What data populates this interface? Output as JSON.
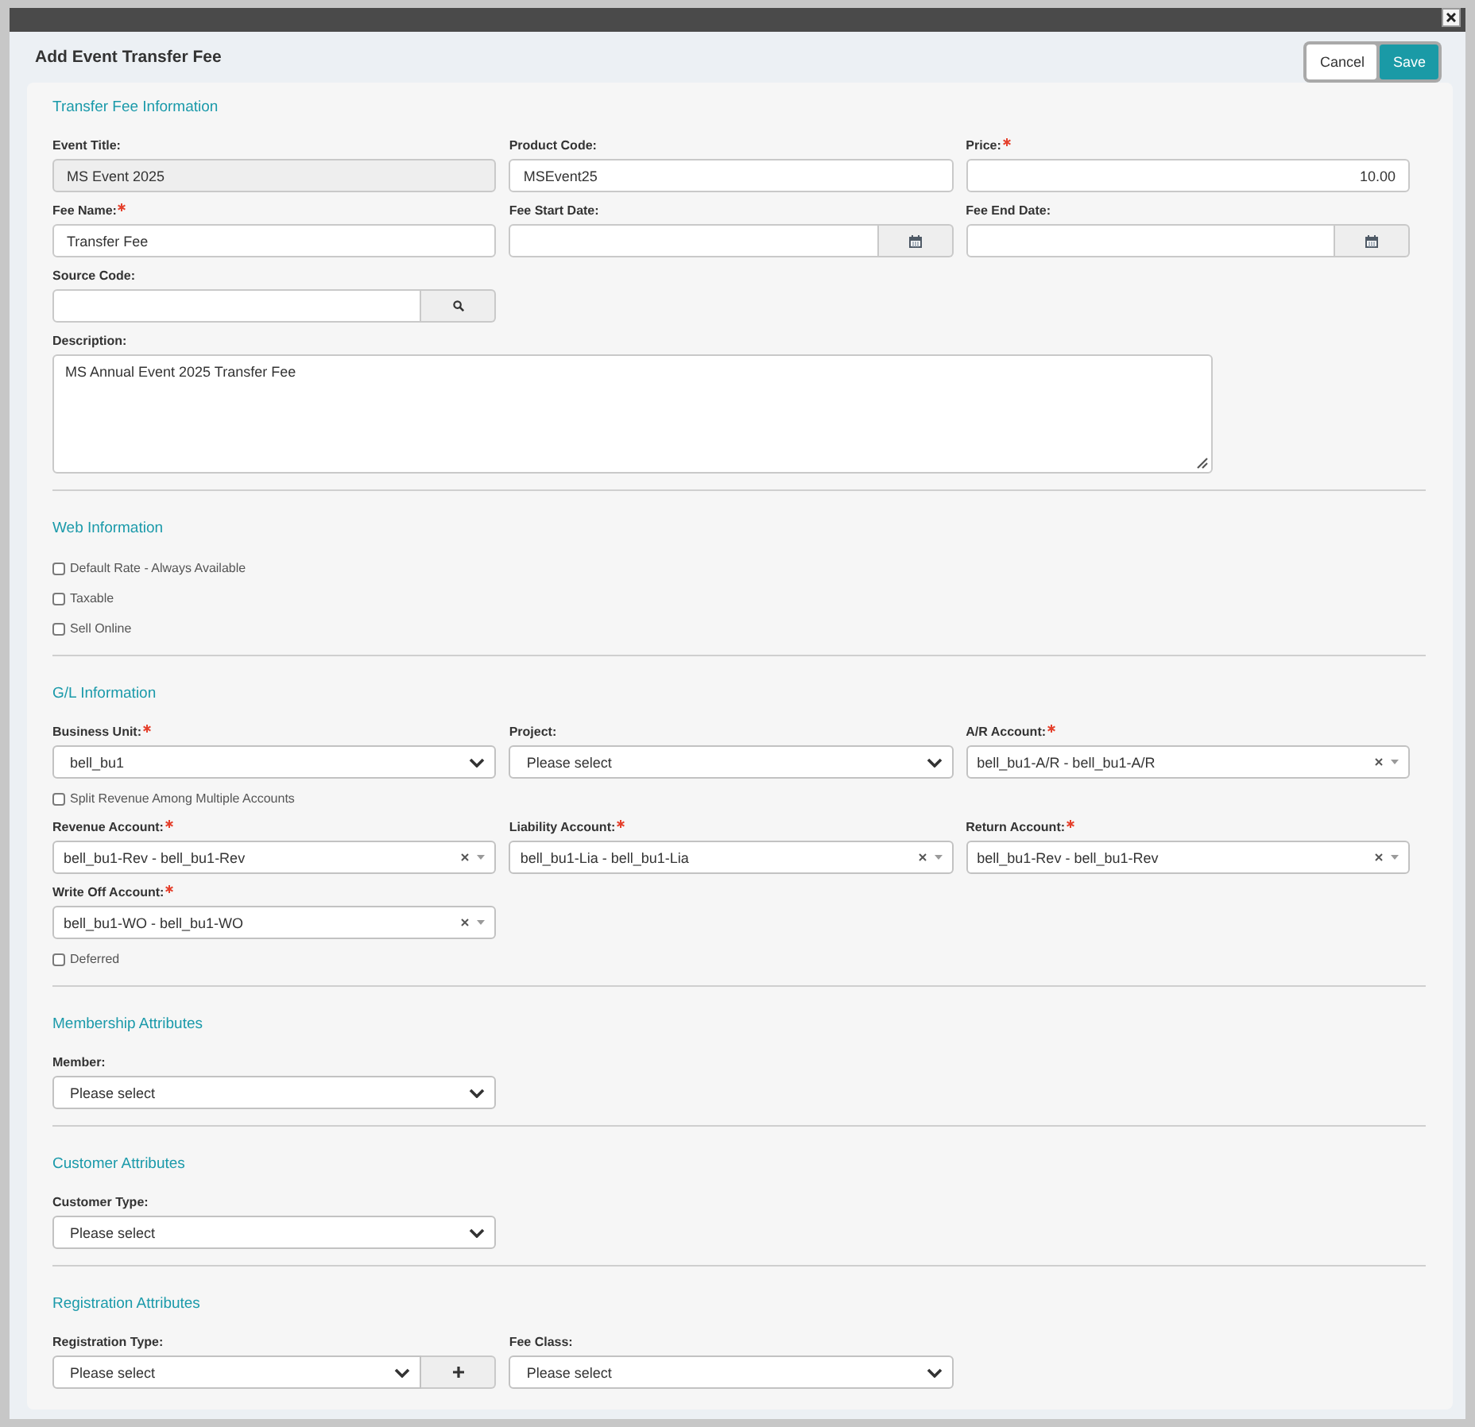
{
  "window": {
    "title": "Add Event Transfer Fee"
  },
  "buttons": [
    {
      "label": "Cancel",
      "kind": "secondary"
    },
    {
      "label": "Save",
      "kind": "primary"
    }
  ],
  "sections": [
    {
      "title": "Transfer Fee Information",
      "rows": [
        {
          "fields": [
            {
              "kind": "text",
              "label": "Event Title:",
              "value": "MS Event 2025",
              "required": false,
              "disabled": true
            },
            {
              "kind": "text",
              "label": "Product Code:",
              "value": "MSEvent25",
              "required": false,
              "disabled": false
            },
            {
              "kind": "number",
              "label": "Price:",
              "value": "10.00",
              "required": true,
              "disabled": false
            }
          ]
        },
        {
          "fields": [
            {
              "kind": "text",
              "label": "Fee Name:",
              "value": "Transfer Fee",
              "required": true,
              "disabled": false
            },
            {
              "kind": "date",
              "label": "Fee Start Date:",
              "required": false,
              "disabled": false
            },
            {
              "kind": "date",
              "label": "Fee End Date:",
              "required": false,
              "disabled": false
            }
          ]
        },
        {
          "fields": [
            {
              "kind": "lookup",
              "label": "Source Code:",
              "required": false,
              "disabled": false
            }
          ]
        },
        {
          "fields": [
            {
              "kind": "textarea",
              "label": "Description:",
              "value": "MS Annual Event 2025 Transfer Fee",
              "required": false,
              "disabled": false
            }
          ]
        }
      ]
    },
    {
      "title": "Web Information",
      "rows": [
        {
          "fields": [
            {
              "kind": "checkbox",
              "label": "Default Rate - Always Available",
              "checked": false
            }
          ]
        },
        {
          "fields": [
            {
              "kind": "checkbox",
              "label": "Taxable",
              "checked": false
            }
          ]
        },
        {
          "fields": [
            {
              "kind": "checkbox",
              "label": "Sell Online",
              "checked": false
            }
          ]
        }
      ]
    },
    {
      "title": "G/L Information",
      "rows": [
        {
          "fields": [
            {
              "kind": "select",
              "label": "Business Unit:",
              "value": "bell_bu1",
              "required": true,
              "disabled": false
            },
            {
              "kind": "select",
              "label": "Project:",
              "value": "Please select",
              "required": false,
              "disabled": false
            },
            {
              "kind": "combo",
              "label": "A/R Account:",
              "value": "bell_bu1-A/R - bell_bu1-A/R",
              "required": true,
              "disabled": false
            }
          ]
        },
        {
          "fields": [
            {
              "kind": "checkbox",
              "label": "Split Revenue Among Multiple Accounts",
              "checked": false
            }
          ]
        },
        {
          "fields": [
            {
              "kind": "combo",
              "label": "Revenue Account:",
              "value": "bell_bu1-Rev - bell_bu1-Rev",
              "required": true,
              "disabled": false
            },
            {
              "kind": "combo",
              "label": "Liability Account:",
              "value": "bell_bu1-Lia - bell_bu1-Lia",
              "required": true,
              "disabled": false
            },
            {
              "kind": "combo",
              "label": "Return Account:",
              "value": "bell_bu1-Rev - bell_bu1-Rev",
              "required": true,
              "disabled": false
            }
          ]
        },
        {
          "fields": [
            {
              "kind": "combo",
              "label": "Write Off Account:",
              "value": "bell_bu1-WO - bell_bu1-WO",
              "required": true,
              "disabled": false
            }
          ]
        },
        {
          "fields": [
            {
              "kind": "checkbox",
              "label": "Deferred",
              "checked": false
            }
          ]
        }
      ]
    },
    {
      "title": "Membership Attributes",
      "rows": [
        {
          "fields": [
            {
              "kind": "select",
              "label": "Member:",
              "value": "Please select",
              "required": false,
              "disabled": false
            }
          ]
        }
      ]
    },
    {
      "title": "Customer Attributes",
      "rows": [
        {
          "fields": [
            {
              "kind": "select",
              "label": "Customer Type:",
              "value": "Please select",
              "required": false,
              "disabled": false
            }
          ]
        }
      ]
    },
    {
      "title": "Registration Attributes",
      "rows": [
        {
          "fields": [
            {
              "kind": "select_add",
              "label": "Registration Type:",
              "value": "Please select",
              "required": false,
              "disabled": false
            },
            {
              "kind": "select",
              "label": "Fee Class:",
              "value": "Please select",
              "required": false,
              "disabled": false
            }
          ]
        }
      ]
    }
  ]
}
